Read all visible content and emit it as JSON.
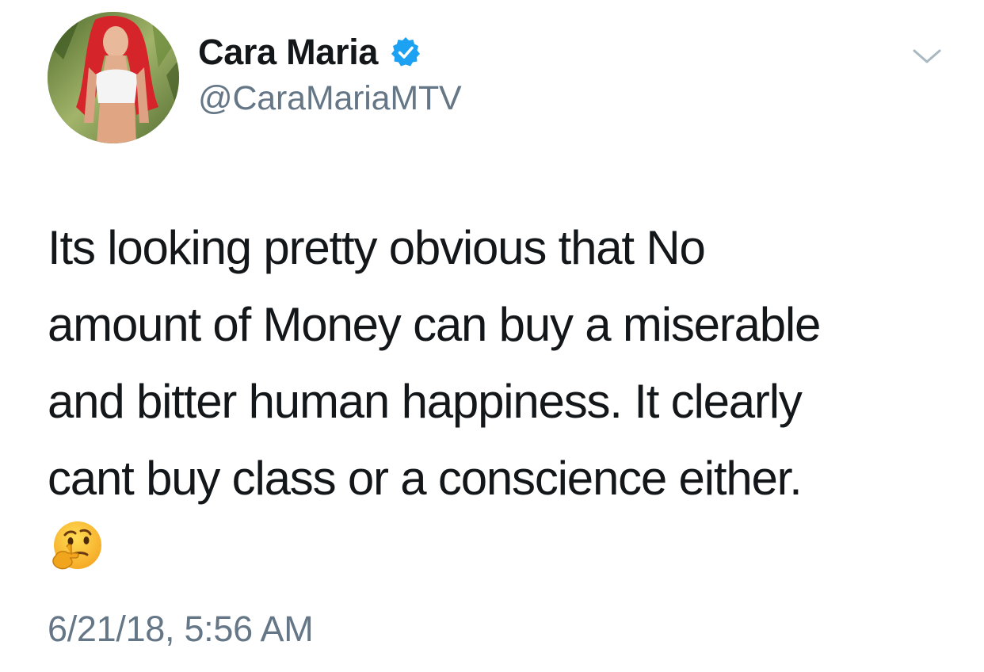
{
  "author": {
    "display_name": "Cara Maria",
    "handle": "@CaraMariaMTV",
    "verified": true,
    "avatar_icon": "profile-photo"
  },
  "tweet": {
    "lines": [
      "Its looking pretty obvious that No",
      "amount of Money can buy a miserable",
      "and bitter human happiness. It  clearly",
      "cant buy class or a conscience either."
    ],
    "emoji": "thinking-face",
    "timestamp": "6/21/18, 5:56 AM"
  },
  "icons": {
    "verified": "verified-badge-icon",
    "menu": "chevron-down-icon"
  },
  "colors": {
    "primary_text": "#14171a",
    "secondary_text": "#657786",
    "verified_blue": "#1da1f2",
    "background": "#ffffff"
  }
}
